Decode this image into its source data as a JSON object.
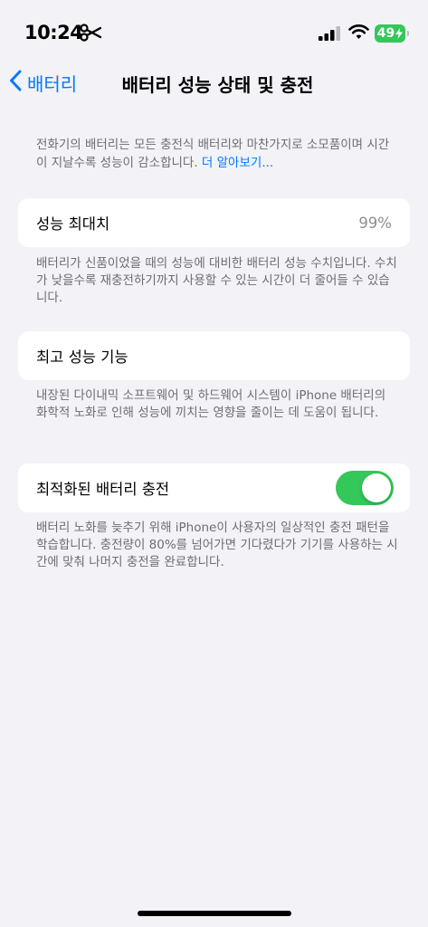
{
  "status_bar": {
    "time": "10:24",
    "battery_percent": "49"
  },
  "nav": {
    "back_label": "배터리",
    "title": "배터리 성능 상태 및 충전"
  },
  "intro": {
    "text": "전화기의 배터리는 모든 충전식 배터리와 마찬가지로 소모품이며 시간이 지날수록 성능이 감소합니다. ",
    "link": "더 알아보기..."
  },
  "max_capacity": {
    "label": "성능 최대치",
    "value": "99%",
    "footnote": "배터리가 신품이었을 때의 성능에 대비한 배터리 성능 수치입니다. 수치가 낮을수록 재충전하기까지 사용할 수 있는 시간이 더 줄어들 수 있습니다."
  },
  "peak_performance": {
    "label": "최고 성능 기능",
    "footnote": "내장된 다이내믹 소프트웨어 및 하드웨어 시스템이 iPhone 배터리의 화학적 노화로 인해 성능에 끼치는 영향을 줄이는 데 도움이 됩니다."
  },
  "optimized_charging": {
    "label": "최적화된 배터리 충전",
    "enabled": true,
    "footnote": "배터리 노화를 늦추기 위해 iPhone이 사용자의 일상적인 충전 패턴을 학습합니다. 충전량이 80%를 넘어가면 기다렸다가 기기를 사용하는 시간에 맞춰 나머지 충전을 완료합니다."
  },
  "colors": {
    "accent": "#007aff",
    "toggle_on": "#34c759",
    "background": "#f2f2f7"
  }
}
